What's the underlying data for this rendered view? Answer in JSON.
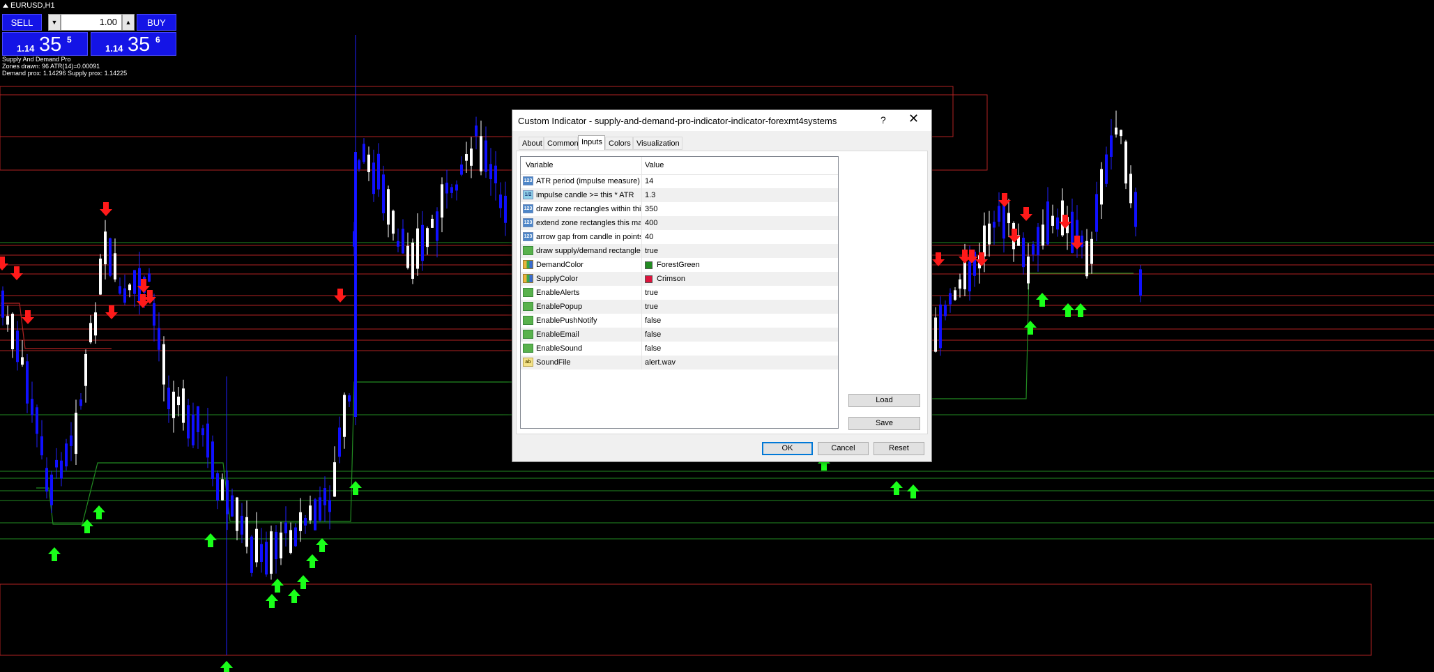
{
  "chart": {
    "symbol": "EURUSD,H1",
    "trade_panel": {
      "sell_label": "SELL",
      "buy_label": "BUY",
      "lot": "1.00",
      "sell_prefix": "1.14",
      "sell_big": "35",
      "sell_super": "5",
      "buy_prefix": "1.14",
      "buy_big": "35",
      "buy_super": "6"
    },
    "info_lines": [
      "Supply And Demand Pro",
      "Zones drawn: 96  ATR(14)=0.00091",
      "Demand prox: 1.14296  Supply prox: 1.14225"
    ]
  },
  "dialog": {
    "title": "Custom Indicator - supply-and-demand-pro-indicator-indicator-forexmt4systems",
    "help": "?",
    "close": "✕",
    "tabs": [
      "About",
      "Common",
      "Inputs",
      "Colors",
      "Visualization"
    ],
    "active_tab": "Inputs",
    "columns": [
      "Variable",
      "Value"
    ],
    "rows": [
      {
        "type": "int",
        "name": "ATR period (impulse measure)",
        "value": "14"
      },
      {
        "type": "double",
        "name": "impulse candle >= this * ATR",
        "value": "1.3"
      },
      {
        "type": "int",
        "name": "draw zone rectangles within this many bars",
        "value": "350"
      },
      {
        "type": "int",
        "name": "extend zone rectangles this many bars to...",
        "value": "400"
      },
      {
        "type": "int",
        "name": "arrow gap from candle in points",
        "value": "40"
      },
      {
        "type": "bool",
        "name": "draw supply/demand rectangles",
        "value": "true"
      },
      {
        "type": "color",
        "name": "DemandColor",
        "value": "ForestGreen",
        "swatch": "#228b22"
      },
      {
        "type": "color",
        "name": "SupplyColor",
        "value": "Crimson",
        "swatch": "#dc143c"
      },
      {
        "type": "bool",
        "name": "EnableAlerts",
        "value": "true"
      },
      {
        "type": "bool",
        "name": "EnablePopup",
        "value": "true"
      },
      {
        "type": "bool",
        "name": "EnablePushNotify",
        "value": "false"
      },
      {
        "type": "bool",
        "name": "EnableEmail",
        "value": "false"
      },
      {
        "type": "bool",
        "name": "EnableSound",
        "value": "false"
      },
      {
        "type": "string",
        "name": "SoundFile",
        "value": "alert.wav"
      }
    ],
    "type_icons": {
      "int": "123",
      "double": "1/2",
      "bool": "",
      "color": "",
      "string": "ab"
    },
    "buttons": {
      "load": "Load",
      "save": "Save",
      "ok": "OK",
      "cancel": "Cancel",
      "reset": "Reset"
    }
  }
}
